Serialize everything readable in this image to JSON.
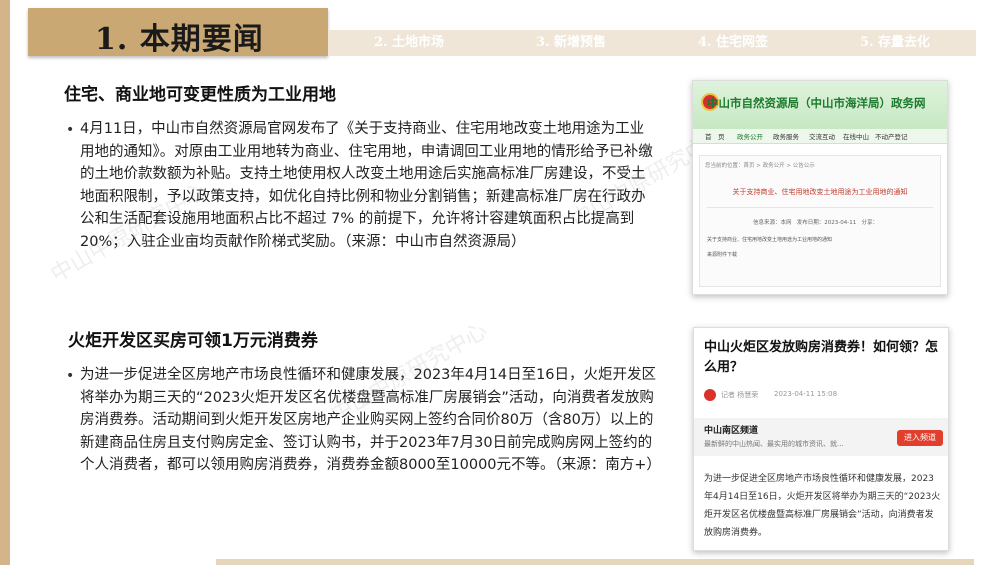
{
  "header": {
    "title": "1. 本期要闻",
    "nav_tabs": [
      {
        "label": "2. 土地市场"
      },
      {
        "label": "3. 新增预售"
      },
      {
        "label": "4. 住宅网签"
      },
      {
        "label": "5. 存量去化"
      }
    ]
  },
  "sections": [
    {
      "title": "住宅、商业地可变更性质为工业用地",
      "bullet": "•",
      "text": "4月11日，中山市自然资源局官网发布了《关于支持商业、住宅用地改变土地用途为工业用地的通知》。对原由工业用地转为商业、住宅用地，申请调回工业用地的情形给予已补缴的土地价款数额为补贴。支持土地使用权人改变土地用途后实施高标准厂房建设，不受土地面积限制，予以政策支持，如优化自持比例和物业分割销售；新建高标准厂房在行政办公和生活配套设施用地面积占比不超过 7% 的前提下，允许将计容建筑面积占比提高到 20%；入驻企业亩均贡献作阶梯式奖励。（来源：中山市自然资源局）"
    },
    {
      "title": "火炬开发区买房可领1万元消费券",
      "bullet": "•",
      "text": "为进一步促进全区房地产市场良性循环和健康发展，2023年4月14日至16日，火炬开发区将举办为期三天的“2023火炬开发区名优楼盘暨高标准厂房展销会”活动，向消费者发放购房消费券。活动期间到火炬开发区房地产企业购买网上签约合同价80万（含80万）以上的新建商品住房且支付购房定金、签订认购书，并于2023年7月30日前完成购房网上签约的个人消费者，都可以领用购房消费券，消费券金额8000至10000元不等。（来源：南方+）"
    }
  ],
  "watermark": "中山中原研究中心",
  "screenshot1": {
    "site_title": "中山市自然资源局（中山市海洋局）政务网",
    "nav": [
      "首　页",
      "政务公开",
      "政务服务",
      "交流互动",
      "在线中山",
      "不动产登记"
    ],
    "breadcrumb": "您当前的位置：首页 > 政务公开 > 公告公示",
    "article_title": "关于支持商业、住宅用地改变土地用途为工业用地的通知",
    "meta_source": "信息来源：本网",
    "meta_date": "发布日期：2023-04-11",
    "meta_share": "分享：",
    "line1": "关于支持商业、住宅用地改变土地用途为工业用地的通知",
    "line2": "来源附件下载"
  },
  "screenshot2": {
    "title": "中山火炬区发放购房消费券！如何领？怎么用？",
    "author": "记者 杨慧荣",
    "date": "2023-04-11 15:08",
    "channel_name": "中山南区频道",
    "channel_desc": "最新鲜的中山热闻、最实用的城市资讯、就...",
    "enter_label": "进入频道",
    "body": "为进一步促进全区房地产市场良性循环和健康发展，2023年4月14日至16日，火炬开发区将举办为期三天的“2023火炬开发区名优楼盘暨高标准厂房展销会”活动，向消费者发放购房消费券。"
  },
  "colors": {
    "accent_gold": "#c9a874",
    "nav_strip": "#efe6d8",
    "gov_green": "#1b7a2e",
    "news_red": "#e23e2d"
  }
}
